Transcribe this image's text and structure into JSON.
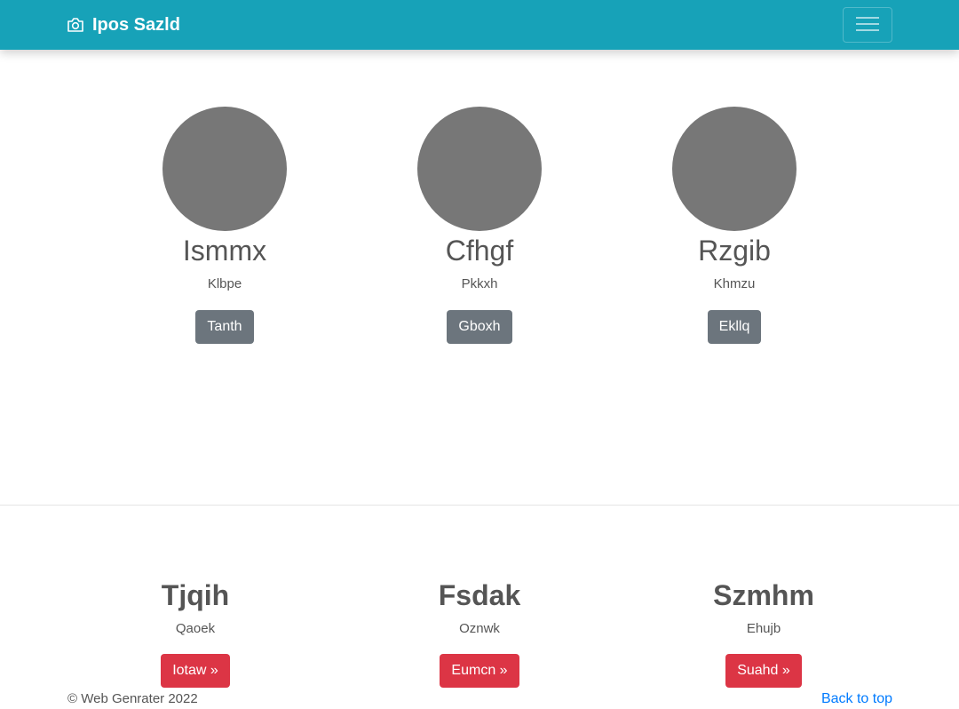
{
  "navbar": {
    "brand": "Ipos Sazld",
    "brand_icon": "camera-icon",
    "toggler_icon": "hamburger-menu-icon",
    "background": "#17a2b8"
  },
  "team": [
    {
      "name": "Ismmx",
      "role": "Klbpe",
      "button": "Tanth"
    },
    {
      "name": "Cfhgf",
      "role": "Pkkxh",
      "button": "Gboxh"
    },
    {
      "name": "Rzgib",
      "role": "Khmzu",
      "button": "Ekllq"
    }
  ],
  "features": [
    {
      "title": "Tjqih",
      "text": "Qaoek",
      "button": "Iotaw »"
    },
    {
      "title": "Fsdak",
      "text": "Oznwk",
      "button": "Eumcn »"
    },
    {
      "title": "Szmhm",
      "text": "Ehujb",
      "button": "Suahd »"
    }
  ],
  "footer": {
    "copyright": "© Web Genrater 2022",
    "back_to_top": "Back to top"
  },
  "colors": {
    "primary": "#17a2b8",
    "secondary": "#6c757d",
    "danger": "#dc3545",
    "link": "#007bff",
    "avatar": "#777777"
  }
}
